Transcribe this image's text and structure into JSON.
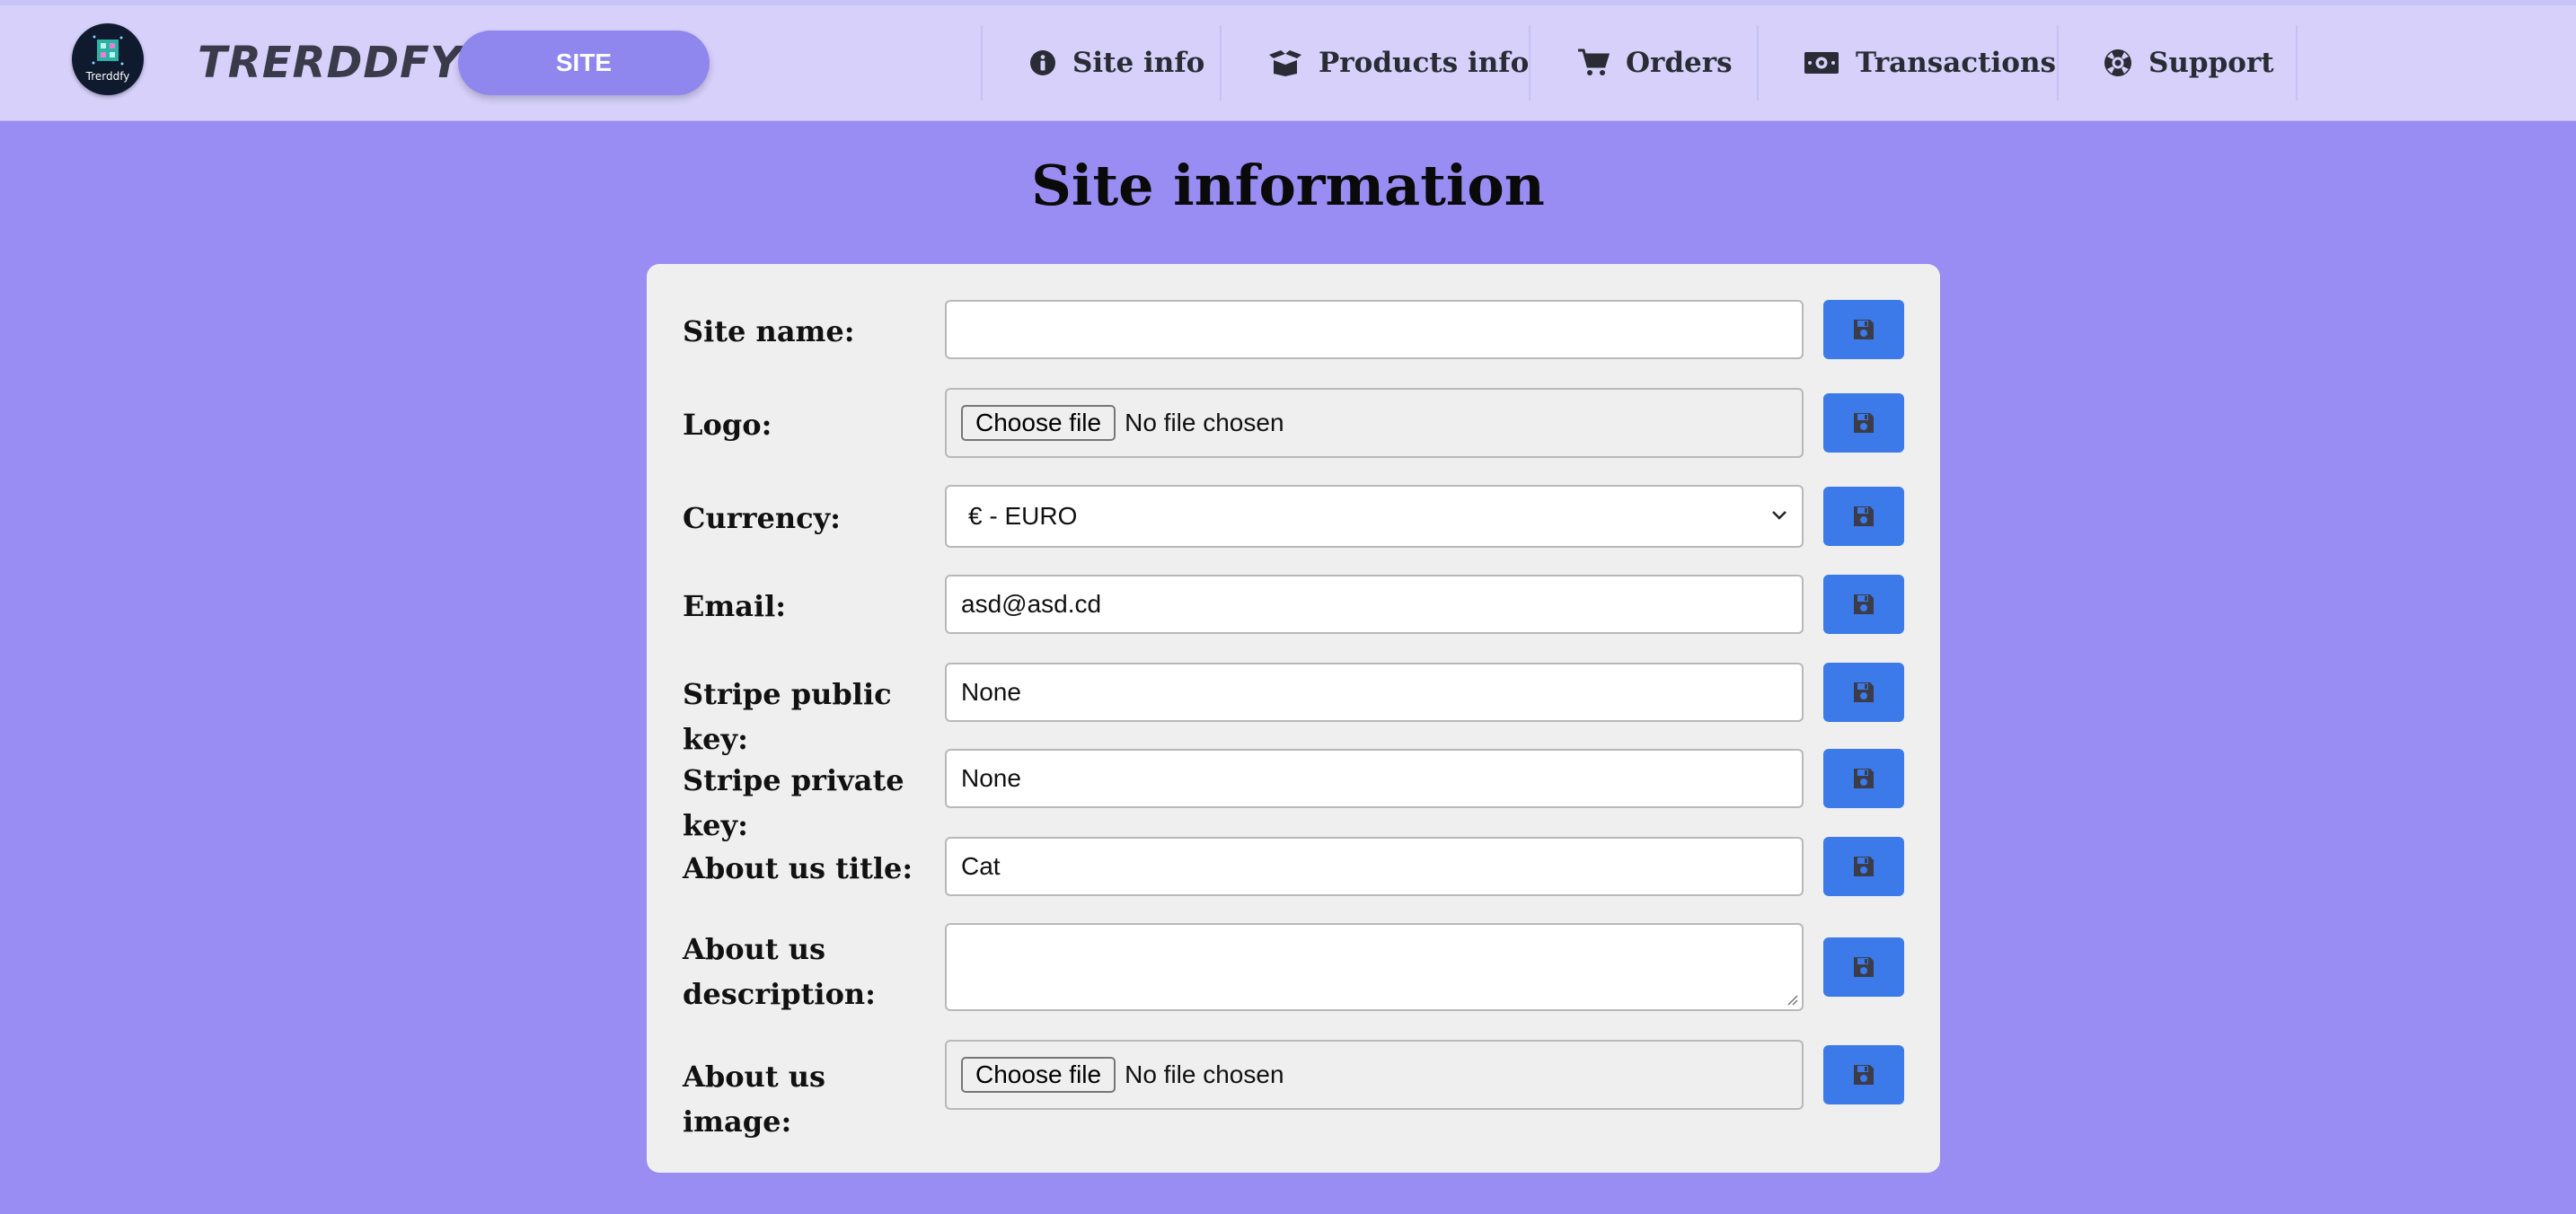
{
  "nav": {
    "logo_text": "Trerddfy",
    "brand": "TRERDDFY",
    "site_button": "SITE",
    "items": [
      {
        "label": "Site info",
        "icon": "info-circle-icon"
      },
      {
        "label": "Products info",
        "icon": "box-open-icon"
      },
      {
        "label": "Orders",
        "icon": "shopping-cart-icon"
      },
      {
        "label": "Transactions",
        "icon": "money-bill-icon"
      },
      {
        "label": "Support",
        "icon": "life-ring-icon"
      }
    ]
  },
  "page": {
    "title": "Site information"
  },
  "form": {
    "site_name": {
      "label": "Site name:",
      "value": ""
    },
    "logo": {
      "label": "Logo:",
      "button": "Choose file",
      "status": "No file chosen"
    },
    "currency": {
      "label": "Currency:",
      "selected": "€ - EURO"
    },
    "email": {
      "label": "Email:",
      "value": "asd@asd.cd"
    },
    "stripe_public": {
      "label": "Stripe public key:",
      "value": "None"
    },
    "stripe_private": {
      "label": "Stripe private key:",
      "value": "None"
    },
    "about_title": {
      "label": "About us title:",
      "value": "Cat"
    },
    "about_description": {
      "label_line1": "About us",
      "label_line2": "description:",
      "value": ""
    },
    "about_image": {
      "label": "About us image:",
      "button": "Choose file",
      "status": "No file chosen"
    }
  },
  "colors": {
    "page_bg": "#998cf2",
    "navbar_bg": "#d6d0fa",
    "site_pill": "#8f86ee",
    "save_button": "#3b7ae8",
    "card_bg": "#efefef"
  }
}
